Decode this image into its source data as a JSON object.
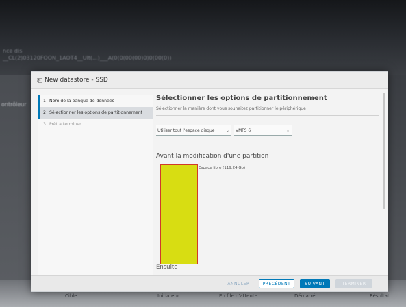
{
  "background": {
    "lines": [
      "nce dis",
      "__CL(2)03120FOON_1AOT4__Ult(...)___A(0(0(00(00)0)0(00(0))",
      "ontrôleur"
    ],
    "taskbar": [
      "Cible",
      "Initiateur",
      "En file d'attente",
      "Démarré",
      "Résultat"
    ]
  },
  "dialog": {
    "title": "New datastore - SSD",
    "steps": [
      {
        "num": "1",
        "label": "Nom de la banque de données"
      },
      {
        "num": "2",
        "label": "Sélectionner les options de partitionnement"
      },
      {
        "num": "3",
        "label": "Prêt à terminer"
      }
    ],
    "heading": "Sélectionner les options de partitionnement",
    "subheading": "Sélectionner la manière dont vous souhaitez partitionner le périphérique",
    "select_space": "Utiliser tout l'espace disque",
    "select_fs": "VMFS 6",
    "before_heading": "Avant la modification d'une partition",
    "free_space": "Espace libre  (119,24 Go)",
    "next_heading": "Ensuite",
    "buttons": {
      "cancel": "ANNULER",
      "previous": "PRÉCÉDENT",
      "next": "SUIVANT",
      "finish": "TERMINER"
    }
  },
  "colors": {
    "accent": "#0079b8",
    "partition_fill": "#d8dd12",
    "partition_border": "#d03a2a"
  }
}
